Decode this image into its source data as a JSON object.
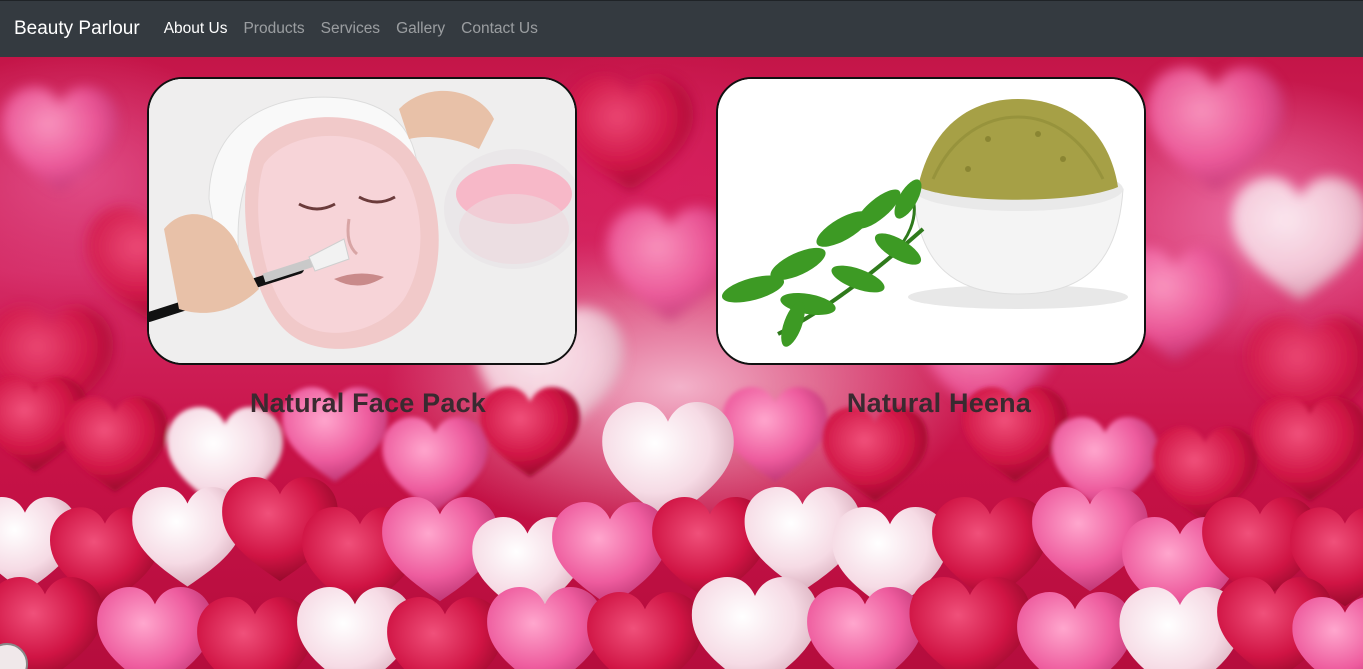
{
  "navbar": {
    "brand": "Beauty Parlour",
    "links": [
      {
        "label": "About Us",
        "active": true
      },
      {
        "label": "Products",
        "active": false
      },
      {
        "label": "Services",
        "active": false
      },
      {
        "label": "Gallery",
        "active": false
      },
      {
        "label": "Contact Us",
        "active": false
      }
    ]
  },
  "products": [
    {
      "title": "Natural Face Pack",
      "image": "face-pack-photo"
    },
    {
      "title": "Natural Heena",
      "image": "heena-powder-photo"
    }
  ],
  "colors": {
    "navbar_bg": "#343a40",
    "nav_active": "#ffffff",
    "nav_inactive": "rgba(255,255,255,0.5)",
    "background_accent": "#c80f45",
    "caption_text": "#3a2a30"
  }
}
